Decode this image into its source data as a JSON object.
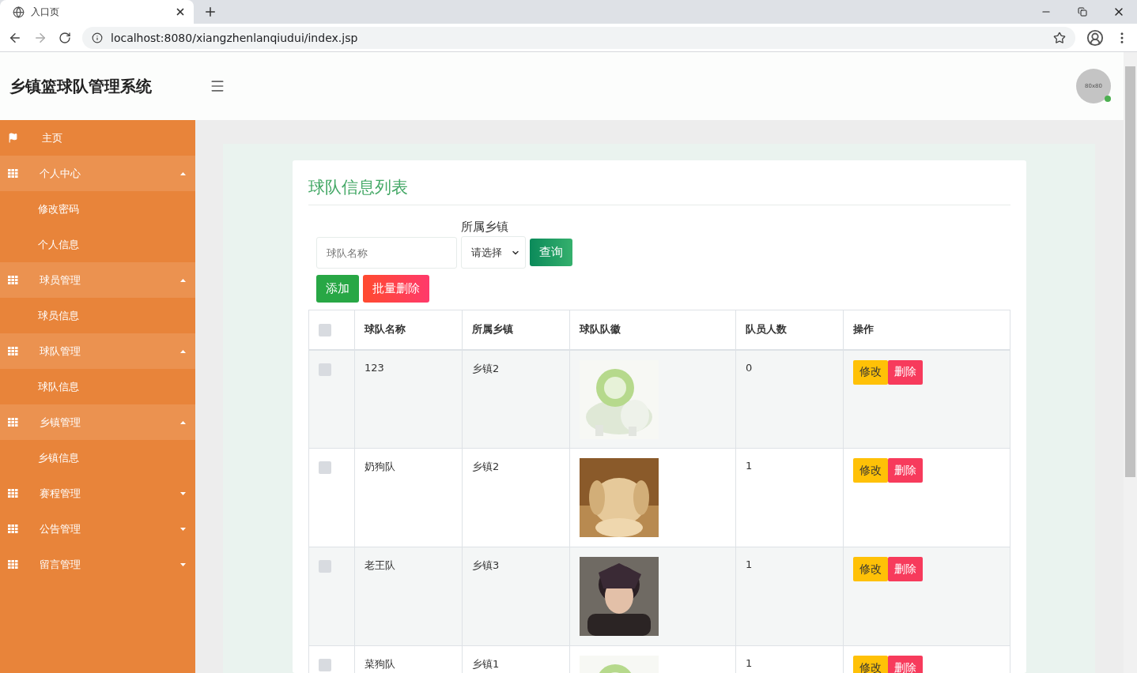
{
  "browser": {
    "tab_title": "入口页",
    "url": "localhost:8080/xiangzhenlanqiudui/index.jsp"
  },
  "header": {
    "title": "乡镇篮球队管理系统",
    "avatar": "80x80",
    "online": true
  },
  "sidebar": {
    "items": [
      {
        "kind": "link",
        "label": "主页"
      },
      {
        "kind": "group",
        "label": "个人中心",
        "expanded": true,
        "children": [
          {
            "label": "修改密码"
          },
          {
            "label": "个人信息"
          }
        ]
      },
      {
        "kind": "group",
        "label": "球员管理",
        "expanded": true,
        "children": [
          {
            "label": "球员信息"
          }
        ]
      },
      {
        "kind": "group",
        "label": "球队管理",
        "expanded": true,
        "children": [
          {
            "label": "球队信息"
          }
        ]
      },
      {
        "kind": "group",
        "label": "乡镇管理",
        "expanded": true,
        "children": [
          {
            "label": "乡镇信息"
          }
        ]
      },
      {
        "kind": "group",
        "label": "赛程管理",
        "expanded": false
      },
      {
        "kind": "group",
        "label": "公告管理",
        "expanded": false
      },
      {
        "kind": "group",
        "label": "留言管理",
        "expanded": false
      }
    ]
  },
  "panel": {
    "title": "球队信息列表",
    "search": {
      "placeholder": "球队名称"
    },
    "town_filter": {
      "label": "所属乡镇",
      "value": "请选择"
    },
    "buttons": {
      "query": "查询",
      "add": "添加",
      "batch_delete": "批量删除"
    },
    "table": {
      "select_all": {
        "checked": false
      },
      "columns": [
        "球队名称",
        "所属乡镇",
        "球队队徽",
        "队员人数",
        "操作"
      ],
      "rows": [
        {
          "checked": false,
          "name": "123",
          "town": "乡镇2",
          "count": "0",
          "edit": "修改",
          "delete": "删除"
        },
        {
          "checked": false,
          "name": "奶狗队",
          "town": "乡镇2",
          "count": "1",
          "edit": "修改",
          "delete": "删除"
        },
        {
          "checked": false,
          "name": "老王队",
          "town": "乡镇3",
          "count": "1",
          "edit": "修改",
          "delete": "删除"
        },
        {
          "checked": false,
          "name": "菜狗队",
          "town": "乡镇1",
          "count": "1",
          "edit": "修改",
          "delete": "删除"
        }
      ]
    }
  }
}
